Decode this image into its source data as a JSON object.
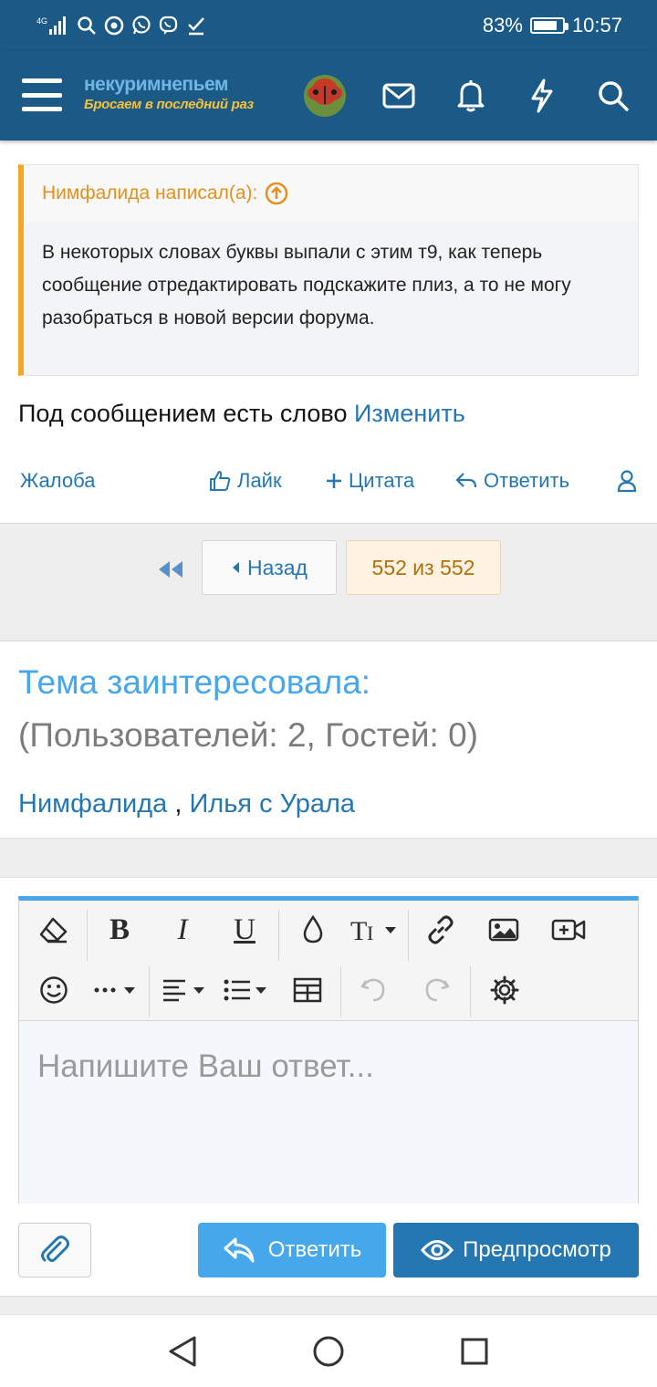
{
  "status_bar": {
    "network": "4G",
    "battery_percent": "83%",
    "battery_level": 0.83,
    "time": "10:57",
    "icons": [
      "signal-icon",
      "search-icon",
      "chrome-icon",
      "whatsapp-icon",
      "viber-icon",
      "check-icon"
    ]
  },
  "header": {
    "logo_line1": "некуримнепьем",
    "logo_line2": "Бросаем в последний раз",
    "icons": [
      "menu-icon",
      "avatar",
      "mail-icon",
      "bell-icon",
      "lightning-icon",
      "search-icon"
    ]
  },
  "quote": {
    "author": "Нимфалида написал(а):",
    "text": "В некоторых словах буквы выпали с этим т9, как теперь сообщение отредактировать подскажите плиз, а то не могу разобраться в новой версии форума."
  },
  "post": {
    "text": "Под сообщением есть слово",
    "link": "Изменить"
  },
  "actions": {
    "report": "Жалоба",
    "like": "Лайк",
    "quote": "Цитата",
    "reply": "Ответить"
  },
  "pagination": {
    "back": "Назад",
    "count": "552 из 552"
  },
  "interested": {
    "title": "Тема заинтересовала:",
    "stats": "(Пользователей: 2, Гостей: 0)",
    "user1": "Нимфалида",
    "separator": ",",
    "user2": "Илья с Урала"
  },
  "editor": {
    "placeholder": "Напишите Ваш ответ..."
  },
  "buttons": {
    "reply": "Ответить",
    "preview": "Предпросмотр"
  },
  "colors": {
    "header_bg": "#1b5a86",
    "link": "#2577b1",
    "accent": "#47a7eb",
    "quote_border": "#f5a623"
  }
}
